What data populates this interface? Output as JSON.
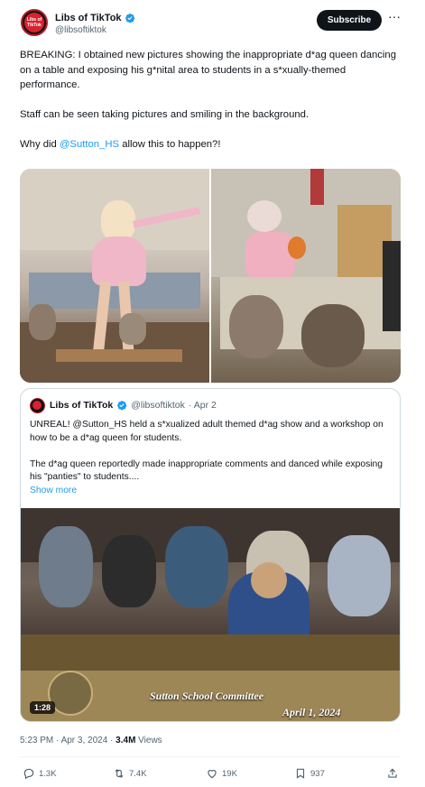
{
  "author": {
    "name": "Libs of TikTok",
    "handle": "@libsoftiktok",
    "avatar_text": "Libs of TikTok"
  },
  "header": {
    "subscribe_label": "Subscribe",
    "more_label": "···"
  },
  "tweet": {
    "paragraph1": "BREAKING: I obtained new pictures showing the inappropriate d*ag queen dancing on a table and exposing his g*nital area to students in a s*xually-themed performance.",
    "paragraph2": "Staff can be seen taking pictures and smiling in the background.",
    "paragraph3_prefix": "Why did ",
    "paragraph3_mention": "@Sutton_HS",
    "paragraph3_suffix": " allow this to happen?!"
  },
  "quote": {
    "name": "Libs of TikTok",
    "handle": "@libsoftiktok",
    "date": "· Apr 2",
    "text1": "UNREAL! @Sutton_HS held a s*xualized adult themed d*ag show and a workshop on how to be a d*ag queen for students.",
    "text2": "The d*ag queen reportedly made inappropriate comments and danced while exposing his \"panties\" to students....",
    "show_more": "Show more",
    "video_duration": "1:28",
    "video_caption": "Sutton School Committee",
    "video_date": "April 1, 2024"
  },
  "meta": {
    "time": "5:23 PM · Apr 3, 2024 · ",
    "views_count": "3.4M",
    "views_label": " Views"
  },
  "actions": {
    "replies": "1.3K",
    "reposts": "7.4K",
    "likes": "19K",
    "bookmarks": "937"
  },
  "colors": {
    "accent": "#1d9bf0",
    "text": "#0f1419",
    "muted": "#536471",
    "border": "#cfd9de"
  }
}
